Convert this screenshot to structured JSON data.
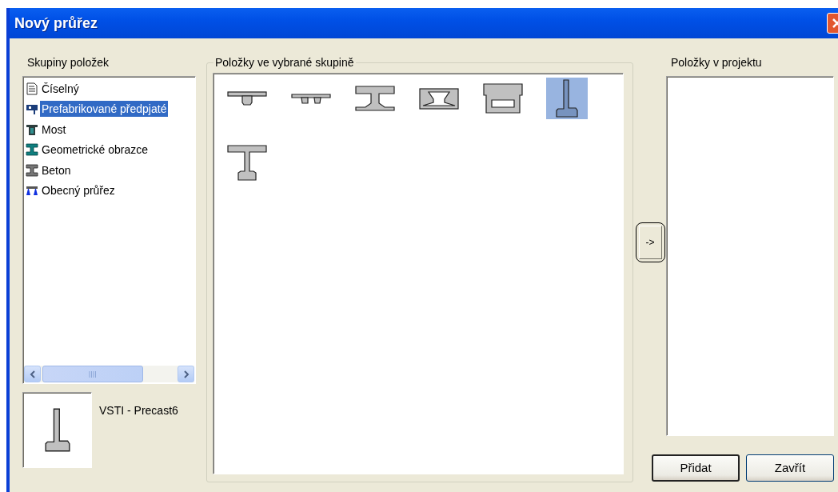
{
  "window": {
    "title": "Nový průřez"
  },
  "groups": {
    "label": "Skupiny položek",
    "items": [
      {
        "kind": "document",
        "label": "Číselný",
        "selected": false
      },
      {
        "kind": "precast",
        "label": "Prefabrikované předpjaté",
        "selected": true
      },
      {
        "kind": "bridge",
        "label": "Most",
        "selected": false
      },
      {
        "kind": "geometric",
        "label": "Geometrické obrazce",
        "selected": false
      },
      {
        "kind": "concrete",
        "label": "Beton",
        "selected": false
      },
      {
        "kind": "general",
        "label": "Obecný průřez",
        "selected": false
      }
    ]
  },
  "preview": {
    "kind": "bulb_tee",
    "caption": "VSTI - Precast6"
  },
  "items_in_group": {
    "label": "Položky ve vybrané skupině",
    "items": [
      {
        "kind": "tee",
        "selected": false
      },
      {
        "kind": "double_tee",
        "selected": false
      },
      {
        "kind": "i_beam",
        "selected": false
      },
      {
        "kind": "box_trapezoid",
        "selected": false
      },
      {
        "kind": "box_hollow",
        "selected": false
      },
      {
        "kind": "bulb_tee",
        "selected": true
      },
      {
        "kind": "i_girder",
        "selected": false
      }
    ]
  },
  "move_button": "->",
  "project_items": {
    "label": "Položky v projektu"
  },
  "buttons": [
    {
      "label": "Přidat",
      "default": true
    },
    {
      "label": "Zavřít",
      "default": false
    }
  ]
}
